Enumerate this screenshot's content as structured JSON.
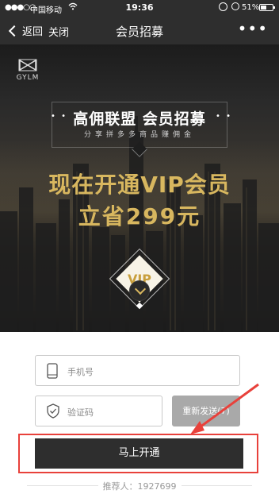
{
  "status_bar": {
    "signal": "●●●○○",
    "carrier": "中国移动",
    "wifi_icon": "wifi-icon",
    "time": "19:36",
    "battery": "51%",
    "battery_level": 0.51
  },
  "nav": {
    "back_label": "返回",
    "close_label": "关闭",
    "title": "会员招募",
    "more_label": "•••"
  },
  "hero": {
    "logo_text": "GYLM",
    "banner_title": "高佣联盟  会员招募",
    "banner_subtitle": "分享拼多多商品赚佣金",
    "sparkle_left": "• •",
    "sparkle_right": "• •",
    "headline_line1": "现在开通VIP会员",
    "headline_line2": "立省299元",
    "vip_badge": "VIP"
  },
  "form": {
    "phone_placeholder": "手机号",
    "code_placeholder": "验证码",
    "resend_label": "重新发送(7)",
    "submit_label": "马上开通",
    "referrer_text": "推荐人：1927699"
  },
  "colors": {
    "dark": "#2e2e2e",
    "gold": "#d8b75f",
    "annotation_red": "#e8413b",
    "resend_disabled": "#a9a9a9"
  }
}
